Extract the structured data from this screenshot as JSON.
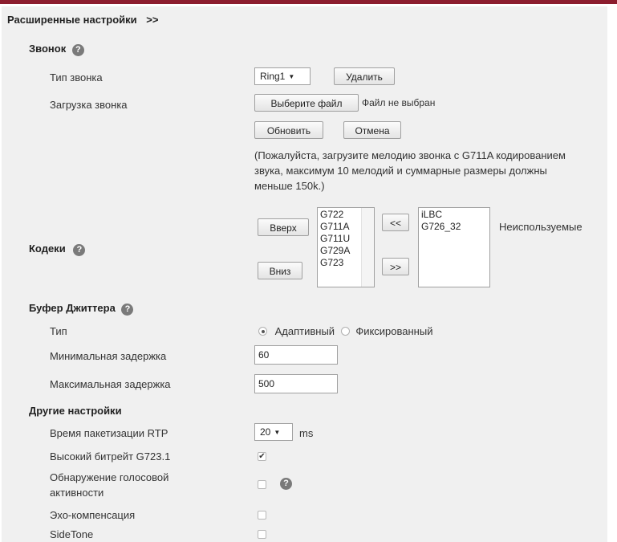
{
  "header": {
    "title": "Расширенные настройки",
    "nav_arrows": ">>"
  },
  "ring": {
    "section_title": "Звонок",
    "type_label": "Тип звонка",
    "type_value": "Ring1",
    "delete_label": "Удалить",
    "upload_label": "Загрузка звонка",
    "choose_file_label": "Выберите файл",
    "no_file_text": "Файл не выбран",
    "refresh_label": "Обновить",
    "cancel_label": "Отмена",
    "note_line1": "(Пожалуйста, загрузите мелодию звонка с G711A кодированием",
    "note_line2": "звука, максимум 10 мелодий и суммарные размеры должны",
    "note_line3": "меньше 150k.)"
  },
  "codecs": {
    "section_title": "Кодеки",
    "up_label": "Вверх",
    "down_label": "Вниз",
    "move_left_label": "<<",
    "move_right_label": ">>",
    "used": [
      "G722",
      "G711A",
      "G711U",
      "G729A",
      "G723"
    ],
    "unused": [
      "iLBC",
      "G726_32"
    ],
    "unused_label": "Неиспользуемые"
  },
  "jitter": {
    "section_title": "Буфер Джиттера",
    "type_label": "Тип",
    "adaptive_label": "Адаптивный",
    "fixed_label": "Фиксированный",
    "selected": "Адаптивный",
    "min_delay_label": "Минимальная задержка",
    "min_delay_value": "60",
    "max_delay_label": "Максимальная задержка",
    "max_delay_value": "500"
  },
  "other": {
    "section_title": "Другие настройки",
    "rtp_label": "Время пакетизации RTP",
    "rtp_value": "20",
    "rtp_unit": "ms",
    "g7231_label": "Высокий битрейт G723.1",
    "g7231_checked": true,
    "vad_label_line1": "Обнаружение голосовой",
    "vad_label_line2": "активности",
    "vad_checked": false,
    "echo_label": "Эхо-компенсация",
    "echo_checked": false,
    "sidetone_label": "SideTone",
    "sidetone_checked": false
  },
  "colors": {
    "top_bar": "#8c1d2e",
    "panel_bg": "#f0f0f0"
  }
}
